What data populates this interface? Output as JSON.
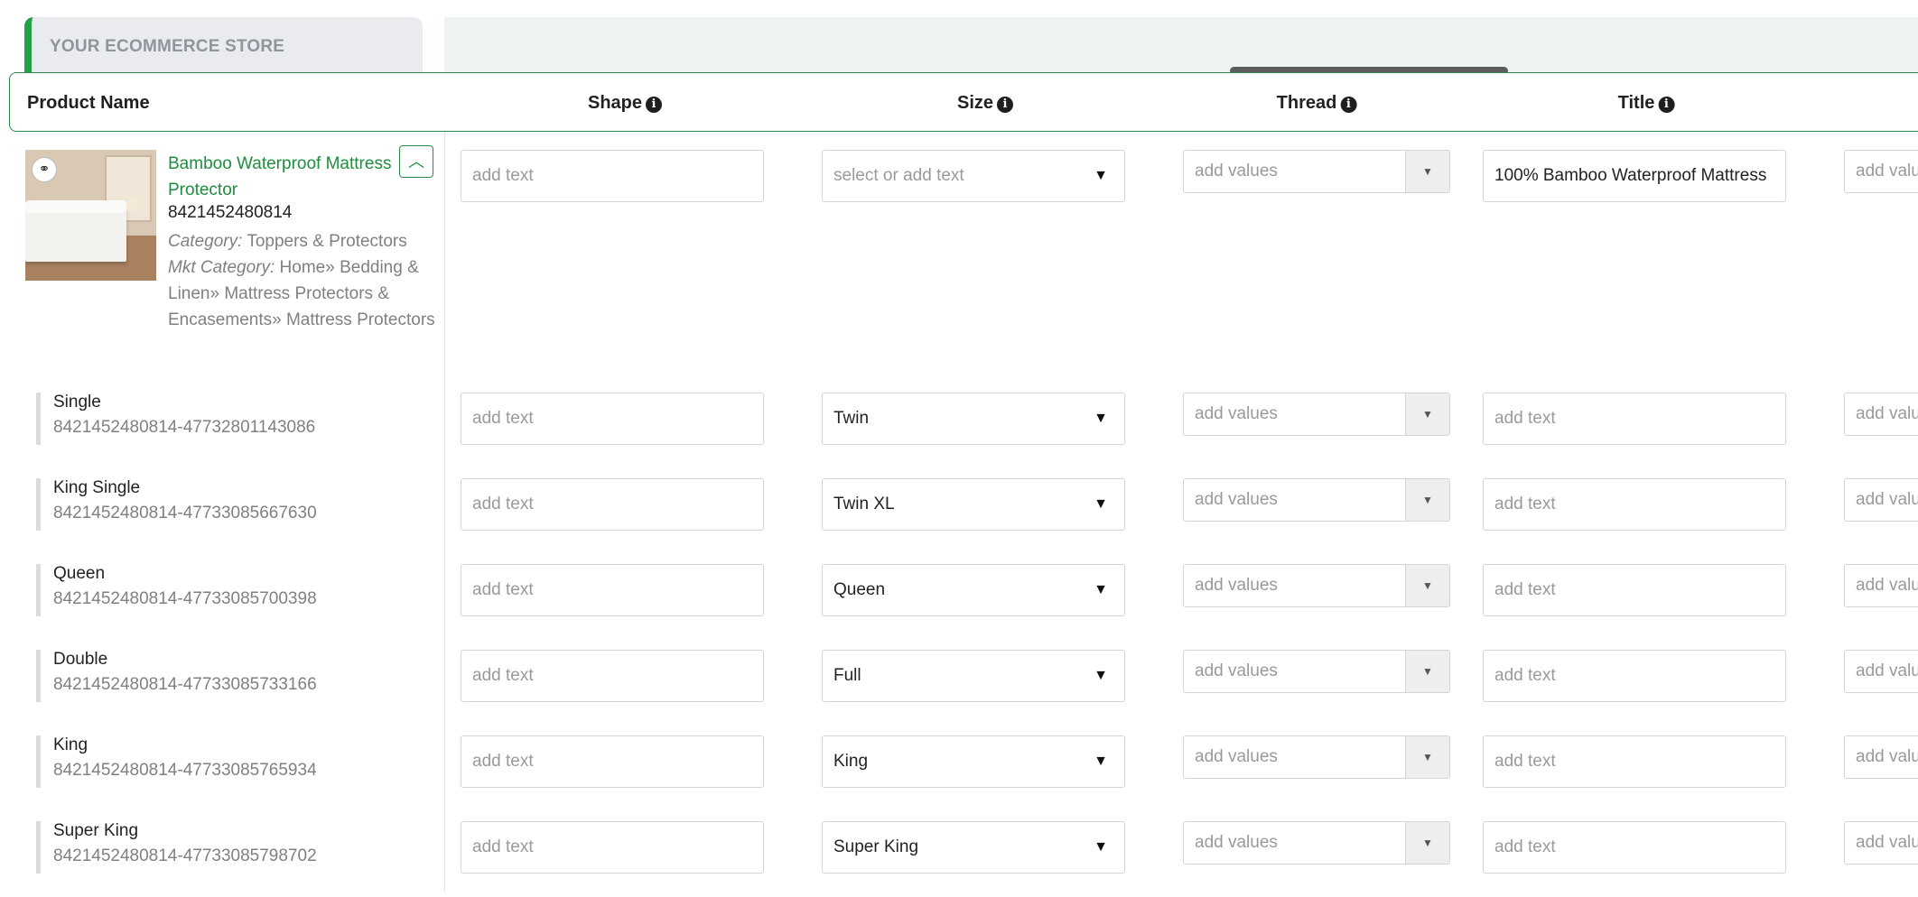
{
  "store": {
    "name": "YOUR ECOMMERCE STORE"
  },
  "columns": {
    "product_name": "Product Name",
    "shape": "Shape",
    "size": "Size",
    "thread": "Thread",
    "title": "Title"
  },
  "icons": {
    "info": "info-icon",
    "bundle": "bundle-icon",
    "collapse": "chevron-up-icon",
    "dropdown": "caret-down-icon"
  },
  "colors": {
    "accent": "#1e8e3e",
    "header_band": "#eef5f1",
    "border": "#2e8b47"
  },
  "product": {
    "title": "Bamboo Waterproof Mattress Protector",
    "sku": "8421452480814",
    "category_label": "Category:",
    "category": "Toppers & Protectors",
    "mkt_category_label": "Mkt Category:",
    "mkt_category": "Home» Bedding & Linen» Mattress Protectors & Encasements» Mattress Protectors",
    "shape_placeholder": "add text",
    "size_placeholder": "select or add text",
    "thread_placeholder": "add values",
    "title_value": "100% Bamboo Waterproof Mattress",
    "next_placeholder": "add values"
  },
  "variants": [
    {
      "name": "Single",
      "sku": "8421452480814-47732801143086",
      "shape_placeholder": "add text",
      "size": "Twin",
      "thread_placeholder": "add values",
      "title_placeholder": "add text",
      "next_placeholder": "add values"
    },
    {
      "name": "King Single",
      "sku": "8421452480814-47733085667630",
      "shape_placeholder": "add text",
      "size": "Twin XL",
      "thread_placeholder": "add values",
      "title_placeholder": "add text",
      "next_placeholder": "add values"
    },
    {
      "name": "Queen",
      "sku": "8421452480814-47733085700398",
      "shape_placeholder": "add text",
      "size": "Queen",
      "thread_placeholder": "add values",
      "title_placeholder": "add text",
      "next_placeholder": "add values"
    },
    {
      "name": "Double",
      "sku": "8421452480814-47733085733166",
      "shape_placeholder": "add text",
      "size": "Full",
      "thread_placeholder": "add values",
      "title_placeholder": "add text",
      "next_placeholder": "add values"
    },
    {
      "name": "King",
      "sku": "8421452480814-47733085765934",
      "shape_placeholder": "add text",
      "size": "King",
      "thread_placeholder": "add values",
      "title_placeholder": "add text",
      "next_placeholder": "add values"
    },
    {
      "name": "Super King",
      "sku": "8421452480814-47733085798702",
      "shape_placeholder": "add text",
      "size": "Super King",
      "thread_placeholder": "add values",
      "title_placeholder": "add text",
      "next_placeholder": "add values"
    }
  ]
}
